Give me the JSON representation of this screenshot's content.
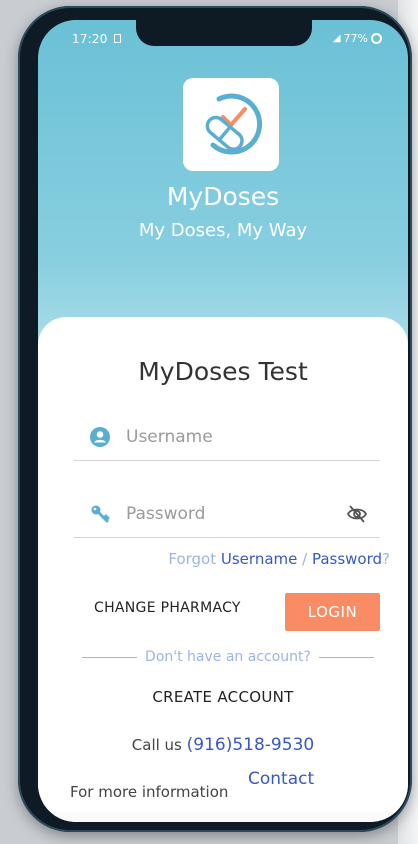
{
  "status_bar": {
    "time": "17:20",
    "battery": "77%"
  },
  "header": {
    "app_name": "MyDoses",
    "tagline": "My Doses, My Way"
  },
  "card": {
    "title": "MyDoses Test",
    "username_placeholder": "Username",
    "password_placeholder": "Password",
    "forgot_prefix": "Forgot ",
    "forgot_username": "Username",
    "forgot_separator": " / ",
    "forgot_password": "Password",
    "forgot_suffix": "?",
    "change_pharmacy_label": "CHANGE PHARMACY",
    "login_label": "LOGIN",
    "no_account_text": "Don't have an account?",
    "create_account_label": "CREATE ACCOUNT",
    "call_us_label": "Call us ",
    "phone_number": "(916)518-9530",
    "more_info_label": "For more information",
    "contact_label": "Contact"
  },
  "colors": {
    "header_blue": "#6bc0d6",
    "login_orange": "#f98c64",
    "link_blue": "#3758c9",
    "icon_blue": "#5aaed0"
  }
}
